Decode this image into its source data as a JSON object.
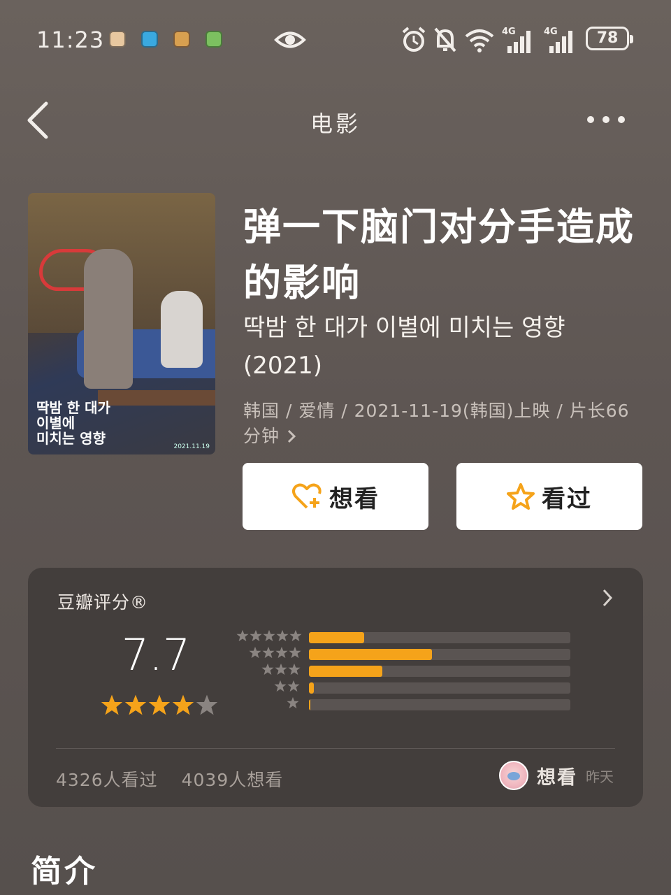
{
  "status_bar": {
    "time": "11:23",
    "battery": "78",
    "network_1": "4G",
    "network_2": "4G",
    "notifications": [
      "app-notification-1",
      "app-notification-2",
      "app-notification-3",
      "app-notification-4"
    ]
  },
  "nav": {
    "title": "电影"
  },
  "poster": {
    "title_text": "딱밤 한 대가\n이별에\n미치는 영향",
    "date": "2021.11.19"
  },
  "movie": {
    "title_zh": "弹一下脑门对分手造成的影响",
    "title_original": "딱밤 한 대가 이별에 미치는 영향",
    "year": "(2021)",
    "meta": "韩国 / 爱情 / 2021-11-19(韩国)上映 / 片长66分钟"
  },
  "actions": {
    "want_label": "想看",
    "seen_label": "看过"
  },
  "rating": {
    "title": "豆瓣评分®",
    "score": "7.7",
    "stars": 4,
    "distribution": [
      {
        "stars": 5,
        "fraction": 0.21
      },
      {
        "stars": 4,
        "fraction": 0.47
      },
      {
        "stars": 3,
        "fraction": 0.28
      },
      {
        "stars": 2,
        "fraction": 0.02
      },
      {
        "stars": 1,
        "fraction": 0.005
      }
    ],
    "seen_count": "4326人看过",
    "want_count": "4039人想看",
    "friend_status": "想看",
    "friend_time": "昨天"
  },
  "colors": {
    "accent": "#f5a31a",
    "background": "#5e5653",
    "card": "#433e3c"
  },
  "section": {
    "intro_title": "简介"
  }
}
